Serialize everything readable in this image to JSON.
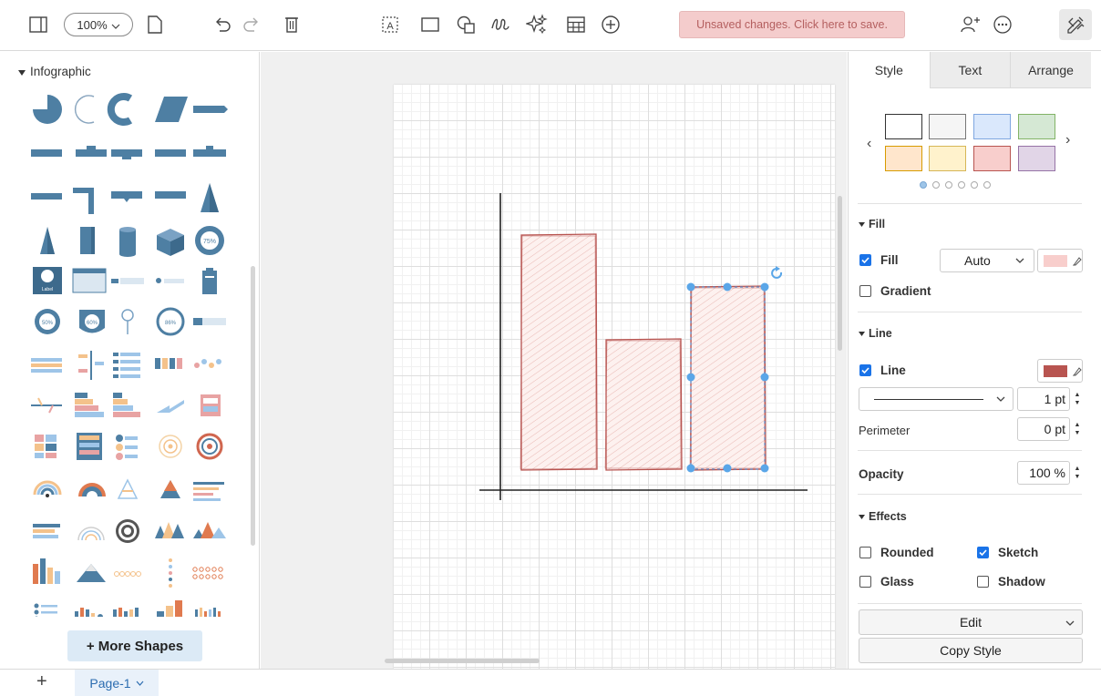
{
  "toolbar": {
    "zoom": "100%",
    "save_banner": "Unsaved changes. Click here to save.",
    "icons": [
      "sidebar-toggle-icon",
      "page-icon",
      "undo-icon",
      "redo-icon",
      "delete-icon",
      "text-icon",
      "rectangle-icon",
      "shapes-icon",
      "freehand-icon",
      "sparkle-icon",
      "table-icon",
      "insert-icon",
      "share-icon",
      "more-icon",
      "format-panel-icon"
    ]
  },
  "sidebar": {
    "library_title": "Infographic",
    "more_shapes_label": "+ More Shapes",
    "badge_labels": [
      "75%",
      "Label",
      "50%",
      "60%",
      "86%"
    ]
  },
  "diagram": {
    "selected_shape": "bar-3",
    "bars": [
      {
        "id": "bar-1",
        "relative_height": 1.0
      },
      {
        "id": "bar-2",
        "relative_height": 0.55
      },
      {
        "id": "bar-3",
        "relative_height": 0.79
      }
    ]
  },
  "format_panel": {
    "tabs": [
      "Style",
      "Text",
      "Arrange"
    ],
    "active_tab": "Style",
    "swatch_colors": [
      "#ffffff",
      "#f5f5f5",
      "#dae8fc",
      "#d5e8d4",
      "#ffe6cc",
      "#fff2cc",
      "#f8cecc",
      "#e1d5e7"
    ],
    "pager_active": 0,
    "fill": {
      "section_title": "Fill",
      "fill_label": "Fill",
      "fill_checked": true,
      "fill_mode": "Auto",
      "fill_color": "#f8cecc",
      "gradient_label": "Gradient",
      "gradient_checked": false
    },
    "line": {
      "section_title": "Line",
      "line_label": "Line",
      "line_checked": true,
      "line_color": "#b85450",
      "width": "1 pt",
      "perimeter_label": "Perimeter",
      "perimeter": "0 pt"
    },
    "opacity": {
      "label": "Opacity",
      "value": "100 %"
    },
    "effects": {
      "section_title": "Effects",
      "rounded_label": "Rounded",
      "rounded_checked": false,
      "sketch_label": "Sketch",
      "sketch_checked": true,
      "glass_label": "Glass",
      "glass_checked": false,
      "shadow_label": "Shadow",
      "shadow_checked": false
    },
    "edit_label": "Edit",
    "copy_style_label": "Copy Style"
  },
  "footer": {
    "add_page": "+",
    "page_tab": "Page-1"
  }
}
